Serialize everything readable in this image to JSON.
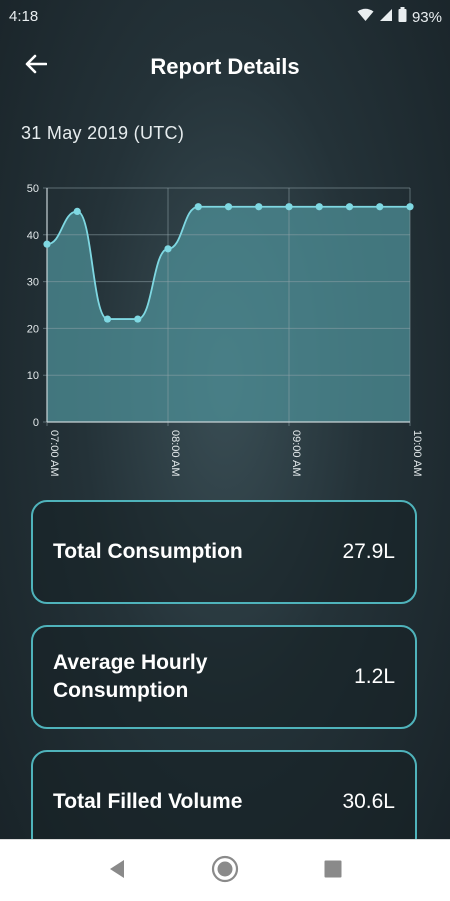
{
  "status_bar": {
    "time": "4:18",
    "battery": "93%"
  },
  "header": {
    "title": "Report Details"
  },
  "report": {
    "date": "31 May 2019 (UTC)"
  },
  "chart_data": {
    "type": "area",
    "title": "",
    "xlabel": "",
    "ylabel": "",
    "ylim": [
      0,
      50
    ],
    "yticks": [
      "0",
      "10",
      "20",
      "30",
      "40",
      "50"
    ],
    "xticks": [
      "07:00 AM",
      "08:00 AM",
      "09:00 AM",
      "10:00 AM"
    ],
    "x_minutes": [
      0,
      15,
      30,
      45,
      60,
      75,
      90,
      105,
      120,
      135,
      150,
      165,
      180
    ],
    "values": [
      38,
      45,
      22,
      22,
      37,
      46,
      46,
      46,
      46,
      46,
      46,
      46,
      46
    ],
    "grid": true,
    "colors": {
      "line": "#7fd8e2",
      "fill": "#4e8f97"
    }
  },
  "metrics": [
    {
      "label": "Total Consumption",
      "value": "27.9L"
    },
    {
      "label": "Average Hourly Consumption",
      "value": "1.2L"
    },
    {
      "label": "Total Filled Volume",
      "value": "30.6L"
    }
  ],
  "colors": {
    "card_border": "#4fb3bb",
    "background": "#243238"
  }
}
